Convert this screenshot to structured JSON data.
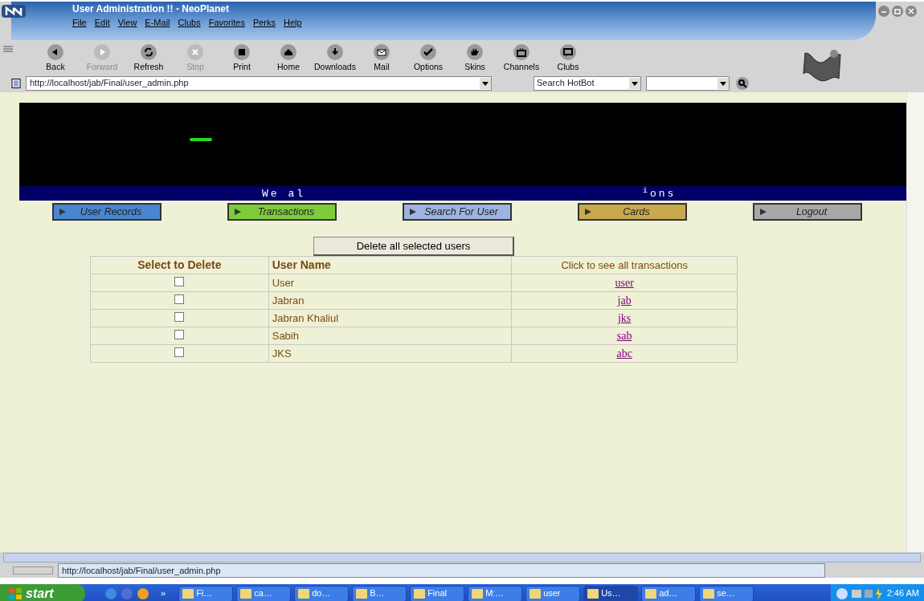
{
  "window": {
    "title": "User Administration !! - NeoPlanet"
  },
  "menu": [
    "File",
    "Edit",
    "View",
    "E-Mail",
    "Clubs",
    "Favorites",
    "Perks",
    "Help"
  ],
  "toolbar": [
    {
      "label": "Back",
      "disabled": false
    },
    {
      "label": "Forward",
      "disabled": true
    },
    {
      "label": "Refresh",
      "disabled": false
    },
    {
      "label": "Stop",
      "disabled": true
    },
    {
      "label": "Print",
      "disabled": false
    },
    {
      "label": "Home",
      "disabled": false
    },
    {
      "label": "Downloads",
      "disabled": false
    },
    {
      "label": "Mail",
      "disabled": false
    },
    {
      "label": "Options",
      "disabled": false
    },
    {
      "label": "Skins",
      "disabled": false
    },
    {
      "label": "Channels",
      "disabled": false
    },
    {
      "label": "Clubs",
      "disabled": false
    }
  ],
  "address": {
    "value": "http://localhost/jab/Final/user_admin.php"
  },
  "search": {
    "engine": "Search HotBot"
  },
  "banner": {
    "left_text": "We al",
    "right_text": "$^{i}$ons"
  },
  "nav": [
    {
      "label": "User Records",
      "color": "#4a86d0"
    },
    {
      "label": "Transactions",
      "color": "#7ccc3c"
    },
    {
      "label": "Search For User",
      "color": "#9db4e0"
    },
    {
      "label": "Cards",
      "color": "#c9a94f"
    },
    {
      "label": "Logout",
      "color": "#a8a8a8"
    }
  ],
  "delete_button": "Delete all selected users",
  "table": {
    "columns": [
      "Select to Delete",
      "User Name",
      "Click to see all transactions"
    ],
    "rows": [
      {
        "checked": false,
        "name": "User",
        "link": "user"
      },
      {
        "checked": false,
        "name": "Jabran",
        "link": "jab"
      },
      {
        "checked": false,
        "name": "Jabran Khaliul",
        "link": "jks"
      },
      {
        "checked": false,
        "name": "Sabih",
        "link": "sab"
      },
      {
        "checked": false,
        "name": "JKS",
        "link": "abc"
      }
    ]
  },
  "status_bar": {
    "text": "http://localhost/jab/Final/user_admin.php"
  },
  "taskbar": {
    "start": "start",
    "chevron": "»",
    "clock": "2:46 AM",
    "items": [
      {
        "label": "Fi…",
        "selected": false
      },
      {
        "label": "ca…",
        "selected": false
      },
      {
        "label": "do…",
        "selected": false
      },
      {
        "label": "B…",
        "selected": false
      },
      {
        "label": "Final",
        "selected": false
      },
      {
        "label": "M:…",
        "selected": false
      },
      {
        "label": "user",
        "selected": false
      },
      {
        "label": "Us…",
        "selected": true
      },
      {
        "label": "ad…",
        "selected": false
      },
      {
        "label": "se…",
        "selected": false
      }
    ]
  }
}
